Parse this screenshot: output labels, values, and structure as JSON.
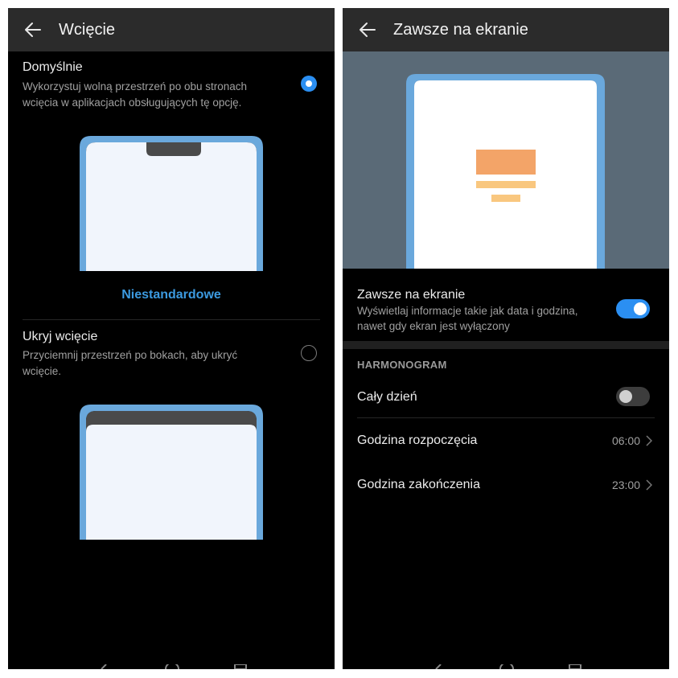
{
  "left": {
    "header": {
      "title": "Wcięcie",
      "back_icon": "arrow-left-icon"
    },
    "options": [
      {
        "title": "Domyślnie",
        "description_line1": "Wykorzystuj wolną przestrzeń po obu stronach",
        "description_line2": "wcięcia w aplikacjach obsługujących tę opcję.",
        "selected": true
      },
      {
        "title": "Ukryj wcięcie",
        "description_line1": "Przyciemnij przestrzeń po bokach, aby ukryć",
        "description_line2": "wcięcie.",
        "selected": false
      }
    ],
    "custom_link": "Niestandardowe"
  },
  "right": {
    "header": {
      "title": "Zawsze na ekranie",
      "back_icon": "arrow-left-icon"
    },
    "feature": {
      "title": "Zawsze na ekranie",
      "description_line1": "Wyświetlaj informacje takie jak data i godzina,",
      "description_line2": "nawet gdy ekran jest wyłączony",
      "enabled": true
    },
    "schedule": {
      "section_title": "HARMONOGRAM",
      "all_day": {
        "label": "Cały dzień",
        "enabled": false
      },
      "start": {
        "label": "Godzina rozpoczęcia",
        "value": "06:00"
      },
      "end": {
        "label": "Godzina zakończenia",
        "value": "23:00"
      }
    }
  },
  "colors": {
    "accent": "#2b8ff2",
    "link": "#3c9ae0",
    "phone_frame": "#6aa8dc",
    "screen_fill": "#f1f5fc",
    "preview_bg": "#5a6a77",
    "bar_orange": "#f3a468",
    "bar_yellow": "#f9c77f"
  }
}
